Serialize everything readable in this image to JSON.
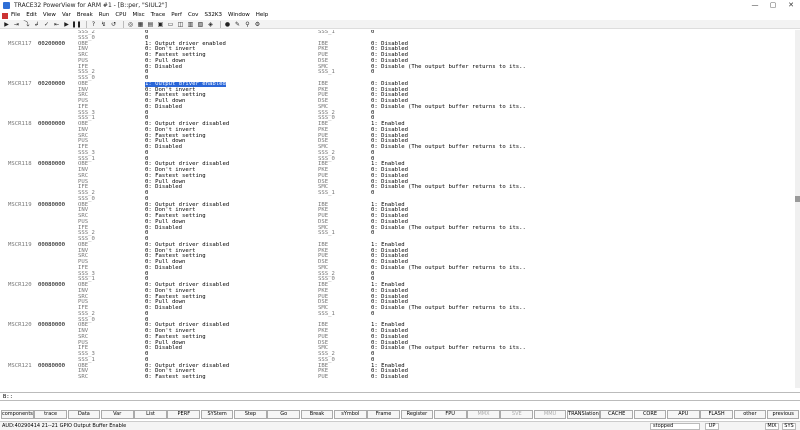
{
  "window": {
    "title": "TRACE32 PowerView for ARM #1 - [B::per, \"SIUL2\"]",
    "controls": [
      "—",
      "▢",
      "✕"
    ]
  },
  "menu": [
    "File",
    "Edit",
    "View",
    "Var",
    "Break",
    "Run",
    "CPU",
    "Misc",
    "Trace",
    "Perf",
    "Cov",
    "S32K3",
    "Window",
    "Help"
  ],
  "toolbar": [
    "▶",
    "⇥",
    "⤵",
    "↲",
    "✓",
    "⇤",
    "▶",
    "❚❚",
    "?",
    "↯",
    "↺",
    "◎",
    "▦",
    "▤",
    "▣",
    "▭",
    "◫",
    "▥",
    "▧",
    "◈",
    "●",
    "✎",
    "⚲",
    "⚙"
  ],
  "lines": [
    {
      "r": "",
      "a": "",
      "f1": "SSS_2",
      "v1": "0",
      "f2": "SSS_1",
      "v2": "0"
    },
    {
      "r": "",
      "a": "",
      "f1": "SSS_0",
      "v1": "0",
      "f2": "",
      "v2": ""
    },
    {
      "r": "MSCR117",
      "a": "00200000",
      "f1": "OBE",
      "v1": "1: Output driver enabled",
      "f2": "IBE",
      "v2": "0: Disabled"
    },
    {
      "r": "",
      "a": "",
      "f1": "INV",
      "v1": "0: Don't invert",
      "f2": "PKE",
      "v2": "0: Disabled"
    },
    {
      "r": "",
      "a": "",
      "f1": "SRC",
      "v1": "0: Fastest setting",
      "f2": "PUE",
      "v2": "0: Disabled"
    },
    {
      "r": "",
      "a": "",
      "f1": "PUS",
      "v1": "0: Pull down",
      "f2": "DSE",
      "v2": "0: Disabled"
    },
    {
      "r": "",
      "a": "",
      "f1": "IFE",
      "v1": "0: Disabled",
      "f2": "SMC",
      "v2": "0: Disable (The output buffer returns to its.."
    },
    {
      "r": "",
      "a": "",
      "f1": "SSS_2",
      "v1": "0",
      "f2": "SSS_1",
      "v2": "0"
    },
    {
      "r": "",
      "a": "",
      "f1": "SSS_0",
      "v1": "0",
      "f2": "",
      "v2": ""
    },
    {
      "r": "MSCR117",
      "a": "00200000",
      "f1": "OBE",
      "v1": "1: Output driver enabled",
      "f2": "IBE",
      "v2": "0: Disabled",
      "hl": true
    },
    {
      "r": "",
      "a": "",
      "f1": "INV",
      "v1": "0: Don't invert",
      "f2": "PKE",
      "v2": "0: Disabled"
    },
    {
      "r": "",
      "a": "",
      "f1": "SRC",
      "v1": "0: Fastest setting",
      "f2": "PUE",
      "v2": "0: Disabled"
    },
    {
      "r": "",
      "a": "",
      "f1": "PUS",
      "v1": "0: Pull down",
      "f2": "DSE",
      "v2": "0: Disabled"
    },
    {
      "r": "",
      "a": "",
      "f1": "IFE",
      "v1": "0: Disabled",
      "f2": "SMC",
      "v2": "0: Disable (The output buffer returns to its.."
    },
    {
      "r": "",
      "a": "",
      "f1": "SSS_3",
      "v1": "0",
      "f2": "SSS_2",
      "v2": "0"
    },
    {
      "r": "",
      "a": "",
      "f1": "SSS_1",
      "v1": "0",
      "f2": "SSS_0",
      "v2": "0"
    },
    {
      "r": "MSCR118",
      "a": "00000000",
      "f1": "OBE",
      "v1": "0: Output driver disabled",
      "f2": "IBE",
      "v2": "1: Enabled"
    },
    {
      "r": "",
      "a": "",
      "f1": "INV",
      "v1": "0: Don't invert",
      "f2": "PKE",
      "v2": "0: Disabled"
    },
    {
      "r": "",
      "a": "",
      "f1": "SRC",
      "v1": "0: Fastest setting",
      "f2": "PUE",
      "v2": "0: Disabled"
    },
    {
      "r": "",
      "a": "",
      "f1": "PUS",
      "v1": "0: Pull down",
      "f2": "DSE",
      "v2": "0: Disabled"
    },
    {
      "r": "",
      "a": "",
      "f1": "IFE",
      "v1": "0: Disabled",
      "f2": "SMC",
      "v2": "0: Disable (The output buffer returns to its.."
    },
    {
      "r": "",
      "a": "",
      "f1": "SSS_3",
      "v1": "0",
      "f2": "SSS_2",
      "v2": "0"
    },
    {
      "r": "",
      "a": "",
      "f1": "SSS_1",
      "v1": "0",
      "f2": "SSS_0",
      "v2": "0"
    },
    {
      "r": "MSCR118",
      "a": "00080000",
      "f1": "OBE",
      "v1": "0: Output driver disabled",
      "f2": "IBE",
      "v2": "1: Enabled"
    },
    {
      "r": "",
      "a": "",
      "f1": "INV",
      "v1": "0: Don't invert",
      "f2": "PKE",
      "v2": "0: Disabled"
    },
    {
      "r": "",
      "a": "",
      "f1": "SRC",
      "v1": "0: Fastest setting",
      "f2": "PUE",
      "v2": "0: Disabled"
    },
    {
      "r": "",
      "a": "",
      "f1": "PUS",
      "v1": "0: Pull down",
      "f2": "DSE",
      "v2": "0: Disabled"
    },
    {
      "r": "",
      "a": "",
      "f1": "IFE",
      "v1": "0: Disabled",
      "f2": "SMC",
      "v2": "0: Disable (The output buffer returns to its.."
    },
    {
      "r": "",
      "a": "",
      "f1": "SSS_2",
      "v1": "0",
      "f2": "SSS_1",
      "v2": "0"
    },
    {
      "r": "",
      "a": "",
      "f1": "SSS_0",
      "v1": "0",
      "f2": "",
      "v2": ""
    },
    {
      "r": "MSCR119",
      "a": "00080000",
      "f1": "OBE",
      "v1": "0: Output driver disabled",
      "f2": "IBE",
      "v2": "1: Enabled"
    },
    {
      "r": "",
      "a": "",
      "f1": "INV",
      "v1": "0: Don't invert",
      "f2": "PKE",
      "v2": "0: Disabled"
    },
    {
      "r": "",
      "a": "",
      "f1": "SRC",
      "v1": "0: Fastest setting",
      "f2": "PUE",
      "v2": "0: Disabled"
    },
    {
      "r": "",
      "a": "",
      "f1": "PUS",
      "v1": "0: Pull down",
      "f2": "DSE",
      "v2": "0: Disabled"
    },
    {
      "r": "",
      "a": "",
      "f1": "IFE",
      "v1": "0: Disabled",
      "f2": "SMC",
      "v2": "0: Disable (The output buffer returns to its.."
    },
    {
      "r": "",
      "a": "",
      "f1": "SSS_2",
      "v1": "0",
      "f2": "SSS_1",
      "v2": "0"
    },
    {
      "r": "",
      "a": "",
      "f1": "SSS_0",
      "v1": "0",
      "f2": "",
      "v2": ""
    },
    {
      "r": "MSCR119",
      "a": "00080000",
      "f1": "OBE",
      "v1": "0: Output driver disabled",
      "f2": "IBE",
      "v2": "1: Enabled"
    },
    {
      "r": "",
      "a": "",
      "f1": "INV",
      "v1": "0: Don't invert",
      "f2": "PKE",
      "v2": "0: Disabled"
    },
    {
      "r": "",
      "a": "",
      "f1": "SRC",
      "v1": "0: Fastest setting",
      "f2": "PUE",
      "v2": "0: Disabled"
    },
    {
      "r": "",
      "a": "",
      "f1": "PUS",
      "v1": "0: Pull down",
      "f2": "DSE",
      "v2": "0: Disabled"
    },
    {
      "r": "",
      "a": "",
      "f1": "IFE",
      "v1": "0: Disabled",
      "f2": "SMC",
      "v2": "0: Disable (The output buffer returns to its.."
    },
    {
      "r": "",
      "a": "",
      "f1": "SSS_3",
      "v1": "0",
      "f2": "SSS_2",
      "v2": "0"
    },
    {
      "r": "",
      "a": "",
      "f1": "SSS_1",
      "v1": "0",
      "f2": "SSS_0",
      "v2": "0"
    },
    {
      "r": "MSCR120",
      "a": "00080000",
      "f1": "OBE",
      "v1": "0: Output driver disabled",
      "f2": "IBE",
      "v2": "1: Enabled"
    },
    {
      "r": "",
      "a": "",
      "f1": "INV",
      "v1": "0: Don't invert",
      "f2": "PKE",
      "v2": "0: Disabled"
    },
    {
      "r": "",
      "a": "",
      "f1": "SRC",
      "v1": "0: Fastest setting",
      "f2": "PUE",
      "v2": "0: Disabled"
    },
    {
      "r": "",
      "a": "",
      "f1": "PUS",
      "v1": "0: Pull down",
      "f2": "DSE",
      "v2": "0: Disabled"
    },
    {
      "r": "",
      "a": "",
      "f1": "IFE",
      "v1": "0: Disabled",
      "f2": "SMC",
      "v2": "0: Disable (The output buffer returns to its.."
    },
    {
      "r": "",
      "a": "",
      "f1": "SSS_2",
      "v1": "0",
      "f2": "SSS_1",
      "v2": "0"
    },
    {
      "r": "",
      "a": "",
      "f1": "SSS_0",
      "v1": "0",
      "f2": "",
      "v2": ""
    },
    {
      "r": "MSCR120",
      "a": "00080000",
      "f1": "OBE",
      "v1": "0: Output driver disabled",
      "f2": "IBE",
      "v2": "1: Enabled"
    },
    {
      "r": "",
      "a": "",
      "f1": "INV",
      "v1": "0: Don't invert",
      "f2": "PKE",
      "v2": "0: Disabled"
    },
    {
      "r": "",
      "a": "",
      "f1": "SRC",
      "v1": "0: Fastest setting",
      "f2": "PUE",
      "v2": "0: Disabled"
    },
    {
      "r": "",
      "a": "",
      "f1": "PUS",
      "v1": "0: Pull down",
      "f2": "DSE",
      "v2": "0: Disabled"
    },
    {
      "r": "",
      "a": "",
      "f1": "IFE",
      "v1": "0: Disabled",
      "f2": "SMC",
      "v2": "0: Disable (The output buffer returns to its.."
    },
    {
      "r": "",
      "a": "",
      "f1": "SSS_3",
      "v1": "0",
      "f2": "SSS_2",
      "v2": "0"
    },
    {
      "r": "",
      "a": "",
      "f1": "SSS_1",
      "v1": "0",
      "f2": "SSS_0",
      "v2": "0"
    },
    {
      "r": "MSCR121",
      "a": "00080000",
      "f1": "OBE",
      "v1": "0: Output driver disabled",
      "f2": "IBE",
      "v2": "1: Enabled"
    },
    {
      "r": "",
      "a": "",
      "f1": "INV",
      "v1": "0: Don't invert",
      "f2": "PKE",
      "v2": "0: Disabled"
    },
    {
      "r": "",
      "a": "",
      "f1": "SRC",
      "v1": "0: Fastest setting",
      "f2": "PUE",
      "v2": "0: Disabled"
    }
  ],
  "cmdline": {
    "prompt": "B::"
  },
  "softkeys": [
    {
      "label": "components",
      "enabled": true
    },
    {
      "label": "trace",
      "enabled": true
    },
    {
      "label": "Data",
      "enabled": true
    },
    {
      "label": "Var",
      "enabled": true
    },
    {
      "label": "List",
      "enabled": true
    },
    {
      "label": "PERF",
      "enabled": true
    },
    {
      "label": "SYStem",
      "enabled": true
    },
    {
      "label": "Step",
      "enabled": true
    },
    {
      "label": "Go",
      "enabled": true
    },
    {
      "label": "Break",
      "enabled": true
    },
    {
      "label": "sYmbol",
      "enabled": true
    },
    {
      "label": "Frame",
      "enabled": true
    },
    {
      "label": "Register",
      "enabled": true
    },
    {
      "label": "FPU",
      "enabled": true
    },
    {
      "label": "MMX",
      "enabled": false
    },
    {
      "label": "SVE",
      "enabled": false
    },
    {
      "label": "MMU",
      "enabled": false
    },
    {
      "label": "TRANSlation",
      "enabled": true
    },
    {
      "label": "CACHE",
      "enabled": true
    },
    {
      "label": "CORE",
      "enabled": true
    },
    {
      "label": "APU",
      "enabled": true
    },
    {
      "label": "FLASH",
      "enabled": true
    },
    {
      "label": "other",
      "enabled": true
    },
    {
      "label": "previous",
      "enabled": true
    }
  ],
  "status": {
    "left": "AUD:40290414  21--21  GPIO Output Buffer Enable",
    "state": "stopped",
    "up": "UP",
    "mix": "MIX",
    "sys": "SYS"
  }
}
